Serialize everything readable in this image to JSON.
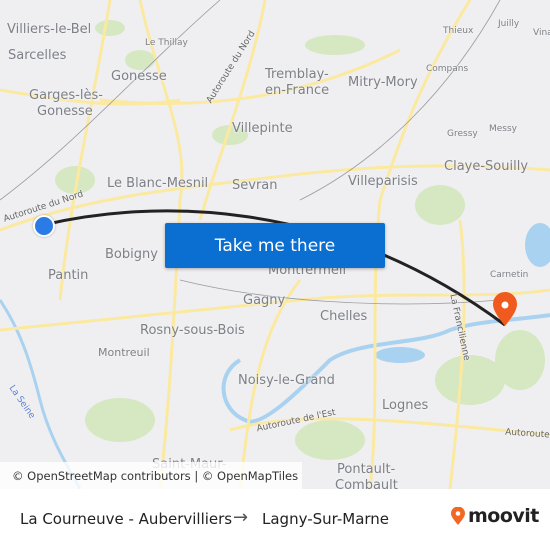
{
  "map": {
    "places": [
      {
        "name": "Villiers-le-Bel",
        "size": "lg"
      },
      {
        "name": "Sarcelles",
        "size": "lg"
      },
      {
        "name": "Le Thillay",
        "size": "sm"
      },
      {
        "name": "Gonesse",
        "size": "lg"
      },
      {
        "name": "Garges-lès-",
        "size": "lg"
      },
      {
        "name": "Gonesse",
        "size": "lg"
      },
      {
        "name": "Tremblay-",
        "size": "lg"
      },
      {
        "name": "en-France",
        "size": "lg"
      },
      {
        "name": "Mitry-Mory",
        "size": "lg"
      },
      {
        "name": "Thieux",
        "size": "sm"
      },
      {
        "name": "Juilly",
        "size": "sm"
      },
      {
        "name": "Vina",
        "size": "sm"
      },
      {
        "name": "Compans",
        "size": "sm"
      },
      {
        "name": "Villepinte",
        "size": "lg"
      },
      {
        "name": "Gressy",
        "size": "sm"
      },
      {
        "name": "Messy",
        "size": "sm"
      },
      {
        "name": "Claye-Souilly",
        "size": "lg"
      },
      {
        "name": "Le Blanc-Mesnil",
        "size": "lg"
      },
      {
        "name": "Sevran",
        "size": "lg"
      },
      {
        "name": "Villeparisis",
        "size": "lg"
      },
      {
        "name": "Bobigny",
        "size": "lg"
      },
      {
        "name": "Montfermeil",
        "size": "lg"
      },
      {
        "name": "Pantin",
        "size": "lg"
      },
      {
        "name": "Carnetin",
        "size": "sm"
      },
      {
        "name": "Gagny",
        "size": "lg"
      },
      {
        "name": "Chelles",
        "size": "lg"
      },
      {
        "name": "Rosny-sous-Bois",
        "size": "lg"
      },
      {
        "name": "Montreuil",
        "size": "md"
      },
      {
        "name": "Noisy-le-Grand",
        "size": "lg"
      },
      {
        "name": "Lognes",
        "size": "lg"
      },
      {
        "name": "Pontault-",
        "size": "lg"
      },
      {
        "name": "Combault",
        "size": "lg"
      },
      {
        "name": "Saint-Maur-",
        "size": "lg"
      }
    ],
    "roads": [
      "Autoroute du Nord",
      "Autoroute du Nord",
      "Autoroute de l'Est",
      "Autoroute",
      "La Francilienne",
      "La Seine"
    ],
    "colors": {
      "land": "#efeff1",
      "road": "#fbe9a0",
      "park": "#cfe6b8",
      "water": "#a9d2f0",
      "route": "#222222",
      "start": "#2b7be6",
      "destination": "#f05a1e"
    },
    "start_marker_icon": "start-dot-icon",
    "destination_marker_icon": "map-pin-icon"
  },
  "cta": {
    "label": "Take me there"
  },
  "attribution": "© OpenStreetMap contributors | © OpenMapTiles",
  "footer": {
    "from": "La Courneuve - Aubervilliers",
    "arrow": "→",
    "to": "Lagny-Sur-Marne",
    "logo": "moovit",
    "brand_color": "#f26722"
  }
}
